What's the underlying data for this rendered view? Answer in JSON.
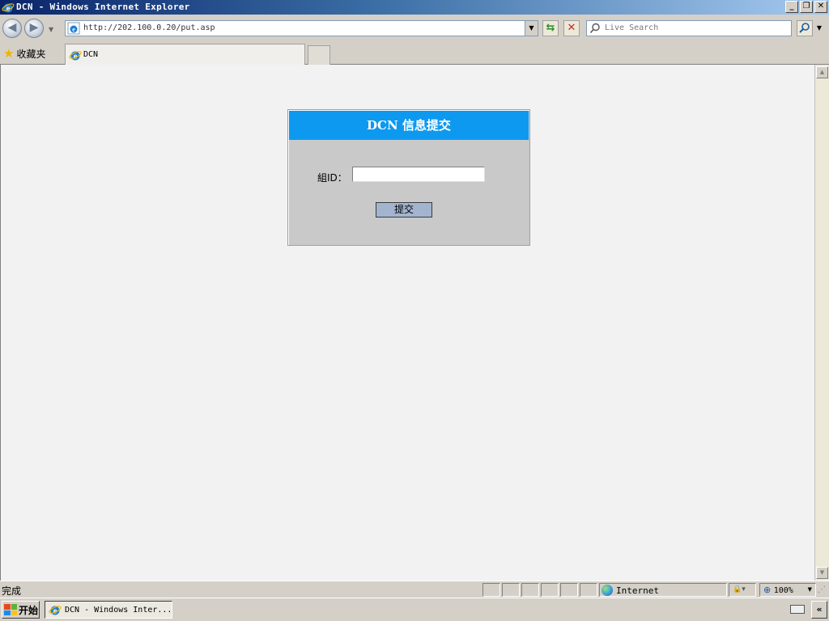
{
  "window": {
    "title": "DCN - Windows Internet Explorer",
    "controls": {
      "minimize": "_",
      "restore": "❐",
      "close": "✕"
    }
  },
  "toolbar": {
    "address_url": "http://202.100.0.20/put.asp",
    "search_placeholder": "Live Search",
    "refresh_icon": "⇆",
    "stop_icon": "✕"
  },
  "tabs": {
    "favorites_label": "收藏夹",
    "items": [
      {
        "label": "DCN",
        "active": true
      }
    ]
  },
  "form": {
    "header": "DCN 信息提交",
    "group_id_label": "組ID：",
    "group_id_value": "",
    "submit_label": "提交"
  },
  "statusbar": {
    "status_text": "完成",
    "zone": "Internet",
    "zoom": "100%"
  },
  "taskbar": {
    "start_label": "开始",
    "task_items": [
      {
        "label": "DCN - Windows Inter..."
      }
    ],
    "expand_label": "«"
  },
  "colors": {
    "form_header_bg": "#0d99f0",
    "form_body_bg": "#c9c9c9",
    "submit_bg": "#a3b4cf",
    "page_bg": "#f2f2f2"
  }
}
